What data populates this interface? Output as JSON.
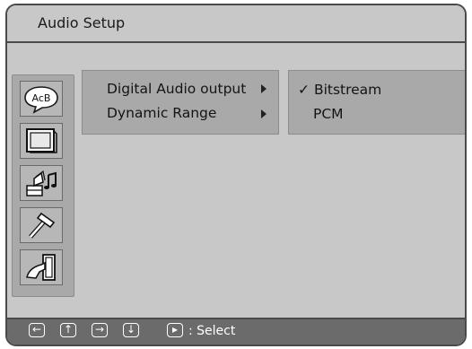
{
  "window": {
    "title": "Audio Setup"
  },
  "sidebar": {
    "items": [
      {
        "icon": "subtitle-abc-icon",
        "label": "AcB"
      },
      {
        "icon": "tv-screen-icon"
      },
      {
        "icon": "gramophone-music-icon"
      },
      {
        "icon": "hammer-tool-icon"
      },
      {
        "icon": "exit-door-icon"
      }
    ]
  },
  "menu": {
    "items": [
      {
        "label": "Digital Audio output"
      },
      {
        "label": "Dynamic Range"
      }
    ]
  },
  "submenu": {
    "options": [
      {
        "label": "Bitstream",
        "selected": true
      },
      {
        "label": "PCM",
        "selected": false
      }
    ]
  },
  "footer": {
    "nav_icons": [
      "left-arrow-icon",
      "up-arrow-icon",
      "right-arrow-icon",
      "down-arrow-icon",
      "play-icon"
    ],
    "hint": ": Select"
  },
  "colors": {
    "background": "#c8c8c8",
    "panel": "#a9a9a9",
    "bottom_bar": "#6b6b6b",
    "border": "#4a4a4a"
  }
}
